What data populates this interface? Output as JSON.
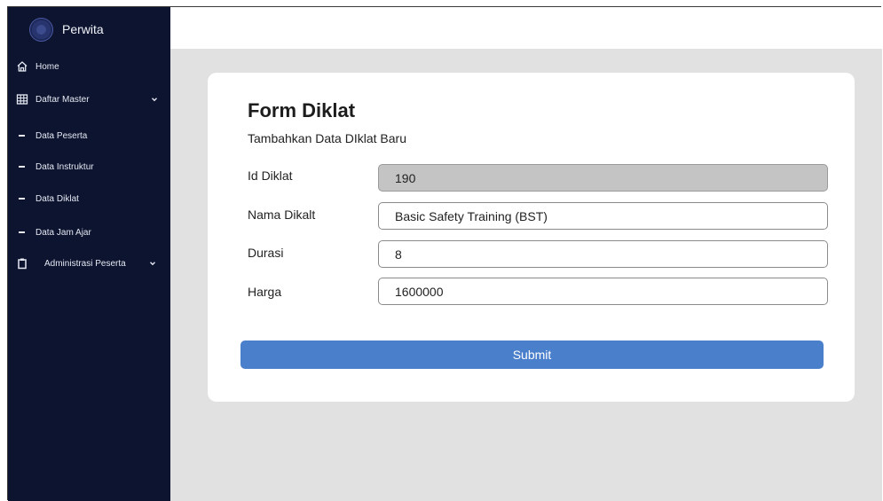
{
  "sidebar": {
    "brand": "Perwita",
    "items": [
      {
        "label": "Home",
        "icon": "home-icon"
      },
      {
        "label": "Daftar Master",
        "icon": "grid-icon",
        "expanded": true
      },
      {
        "label": "Data Peserta"
      },
      {
        "label": "Data Instruktur"
      },
      {
        "label": "Data Diklat"
      },
      {
        "label": "Data Jam Ajar"
      },
      {
        "label": "Administrasi Peserta",
        "icon": "clipboard-icon",
        "expanded": true
      }
    ]
  },
  "form": {
    "title": "Form Diklat",
    "subtitle": "Tambahkan Data DIklat Baru",
    "fields": [
      {
        "label": "Id Diklat",
        "value": "190",
        "readonly": true
      },
      {
        "label": "Nama Dikalt",
        "value": "Basic Safety Training (BST)"
      },
      {
        "label": "Durasi",
        "value": "8"
      },
      {
        "label": "Harga",
        "value": "1600000"
      }
    ],
    "submit_label": "Submit"
  },
  "colors": {
    "sidebar_bg": "#0c1430",
    "content_bg": "#e1e1e1",
    "accent": "#4a7fcb",
    "readonly_bg": "#c4c4c4"
  }
}
